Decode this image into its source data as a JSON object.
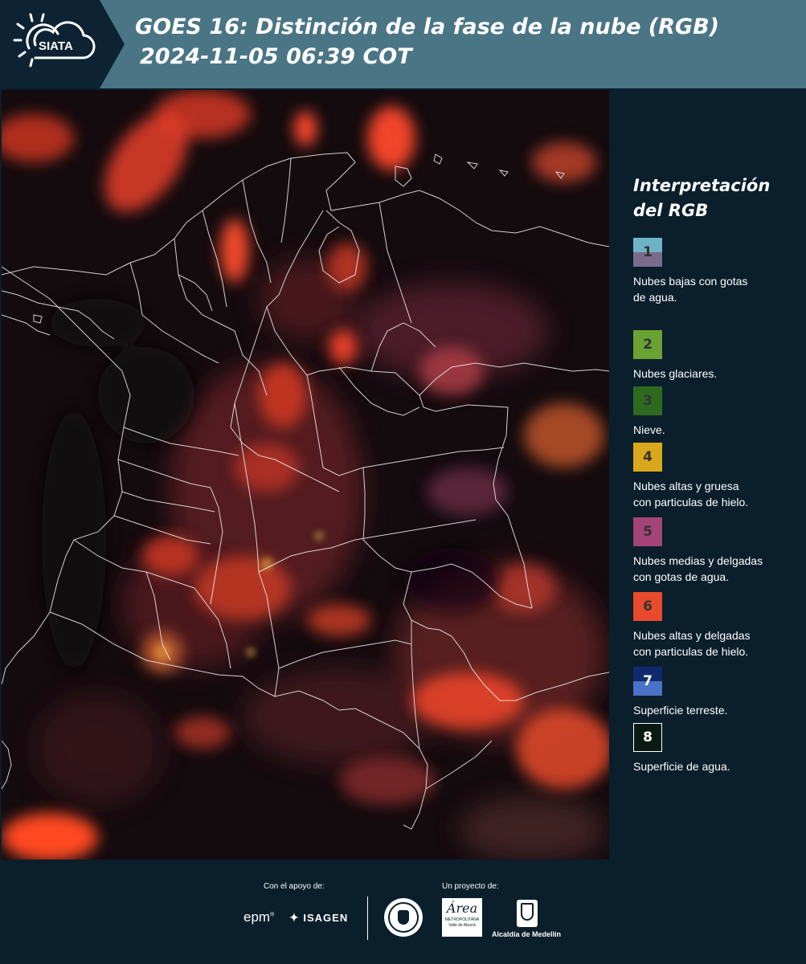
{
  "header": {
    "logo_text": "SIATA",
    "title_line1": "GOES 16: Distinción de la fase de la nube (RGB)",
    "title_line2": "2024-11-05 06:39 COT"
  },
  "legend": {
    "title_line1": "Interpretación",
    "title_line2": "del RGB",
    "items": [
      {
        "number": "1",
        "label_line1": "Nubes bajas con gotas",
        "label_line2": "de agua.",
        "color_top": "#6fb4c4",
        "color_bottom": "#7a6b8c"
      },
      {
        "number": "2",
        "label_line1": "Nubes glaciares.",
        "label_line2": "",
        "color_top": "#6aa233",
        "color_bottom": "#6aa233"
      },
      {
        "number": "3",
        "label_line1": "Nieve.",
        "label_line2": "",
        "color_top": "#2d6a1e",
        "color_bottom": "#2d6a1e"
      },
      {
        "number": "4",
        "label_line1": "Nubes altas y gruesa",
        "label_line2": "con particulas de hielo.",
        "color_top": "#d9a81c",
        "color_bottom": "#d9a81c"
      },
      {
        "number": "5",
        "label_line1": "Nubes medias y delgadas",
        "label_line2": "con gotas de agua.",
        "color_top": "#a4437a",
        "color_bottom": "#a4437a"
      },
      {
        "number": "6",
        "label_line1": "Nubes altas y delgadas",
        "label_line2": "con particulas de hielo.",
        "color_top": "#e84a2b",
        "color_bottom": "#e84a2b"
      },
      {
        "number": "7",
        "label_line1": "Superficie terreste.",
        "label_line2": "",
        "color_top": "#0f2a6e",
        "color_bottom": "#4a72c8"
      },
      {
        "number": "8",
        "label_line1": "Superficie de agua.",
        "label_line2": "",
        "color_top": "#0a1a12",
        "color_bottom": "#0a1a12"
      }
    ]
  },
  "footer": {
    "support_label": "Con el apoyo de:",
    "project_label": "Un proyecto de:",
    "epm": "epm",
    "isagen": "ISAGEN",
    "area_main": "Área",
    "area_sub1": "METROPOLITANA",
    "area_sub2": "Valle de Aburrá",
    "alcaldia": "Alcaldía de Medellín"
  },
  "colors": {
    "header_bg": "#4a7585",
    "page_bg": "#0b1e2c",
    "cloud_red": "#e8402a"
  }
}
